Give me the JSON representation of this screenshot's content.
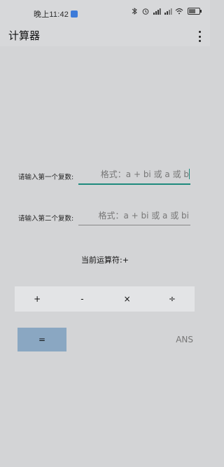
{
  "status": {
    "time": "晚上11:42"
  },
  "app": {
    "title": "计算器"
  },
  "inputs": {
    "first_label": "请输入第一个复数:",
    "first_placeholder": "格式：a + bi 或 a 或 b",
    "second_label": "请输入第二个复数:",
    "second_placeholder": "格式：a + bi 或 a 或 bi"
  },
  "operator": {
    "text": "当前运算符:+"
  },
  "operations": {
    "plus": "+",
    "minus": "-",
    "times": "×",
    "divide": "÷"
  },
  "actions": {
    "equals": "=",
    "ans": "ANS"
  },
  "colors": {
    "background": "#d3d4d6",
    "equals_button": "#8aa7c2",
    "accent_underline": "#1e8a7d"
  },
  "icons": [
    "bluetooth-icon",
    "alarm-icon",
    "signal-icon",
    "wifi-icon",
    "battery-icon",
    "more-vert-icon"
  ]
}
